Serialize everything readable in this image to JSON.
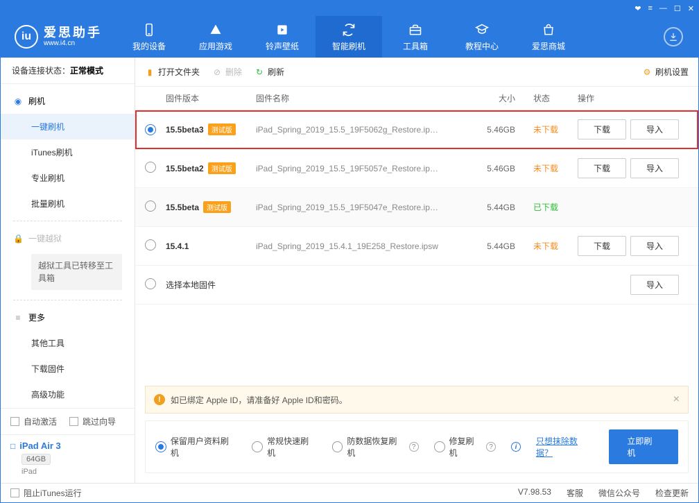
{
  "titlebar_icons": [
    "gift",
    "menu",
    "min",
    "max",
    "close"
  ],
  "logo": {
    "cn": "爱思助手",
    "url": "www.i4.cn"
  },
  "nav": [
    {
      "id": "device",
      "label": "我的设备"
    },
    {
      "id": "apps",
      "label": "应用游戏"
    },
    {
      "id": "ring",
      "label": "铃声壁纸"
    },
    {
      "id": "flash",
      "label": "智能刷机"
    },
    {
      "id": "toolbox",
      "label": "工具箱"
    },
    {
      "id": "tutorial",
      "label": "教程中心"
    },
    {
      "id": "store",
      "label": "爱思商城"
    }
  ],
  "nav_active": "flash",
  "sidebar": {
    "conn_label": "设备连接状态：",
    "conn_value": "正常模式",
    "flash_header": "刷机",
    "flash_items": [
      "一键刷机",
      "iTunes刷机",
      "专业刷机",
      "批量刷机"
    ],
    "flash_active": 0,
    "jailbreak_header": "一键越狱",
    "jailbreak_note": "越狱工具已转移至工具箱",
    "more_header": "更多",
    "more_items": [
      "其他工具",
      "下载固件",
      "高级功能"
    ],
    "auto_activate": "自动激活",
    "skip_guide": "跳过向导",
    "device_name": "iPad Air 3",
    "device_cap": "64GB",
    "device_type": "iPad"
  },
  "toolbar": {
    "open": "打开文件夹",
    "delete": "删除",
    "refresh": "刷新",
    "settings": "刷机设置"
  },
  "columns": {
    "ver": "固件版本",
    "name": "固件名称",
    "size": "大小",
    "status": "状态",
    "action": "操作"
  },
  "beta_tag": "测试版",
  "btn_download": "下载",
  "btn_import": "导入",
  "rows": [
    {
      "ver": "15.5beta3",
      "beta": true,
      "name": "iPad_Spring_2019_15.5_19F5062g_Restore.ip…",
      "size": "5.46GB",
      "status": "未下载",
      "status_class": "un",
      "sel": true,
      "dl": true,
      "hl": true
    },
    {
      "ver": "15.5beta2",
      "beta": true,
      "name": "iPad_Spring_2019_15.5_19F5057e_Restore.ip…",
      "size": "5.46GB",
      "status": "未下载",
      "status_class": "un",
      "dl": true
    },
    {
      "ver": "15.5beta",
      "beta": true,
      "name": "iPad_Spring_2019_15.5_19F5047e_Restore.ip…",
      "size": "5.44GB",
      "status": "已下载",
      "status_class": "dl",
      "alt": true
    },
    {
      "ver": "15.4.1",
      "beta": false,
      "name": "iPad_Spring_2019_15.4.1_19E258_Restore.ipsw",
      "size": "5.44GB",
      "status": "未下载",
      "status_class": "un",
      "dl": true
    }
  ],
  "local_row": "选择本地固件",
  "notice": "如已绑定 Apple ID，请准备好 Apple ID和密码。",
  "options": {
    "keep": "保留用户资料刷机",
    "fast": "常规快速刷机",
    "anti": "防数据恢复刷机",
    "repair": "修复刷机",
    "erase_link": "只想抹除数据？",
    "flash_btn": "立即刷机"
  },
  "statusbar": {
    "block_itunes": "阻止iTunes运行",
    "version": "V7.98.53",
    "service": "客服",
    "wechat": "微信公众号",
    "update": "检查更新"
  }
}
